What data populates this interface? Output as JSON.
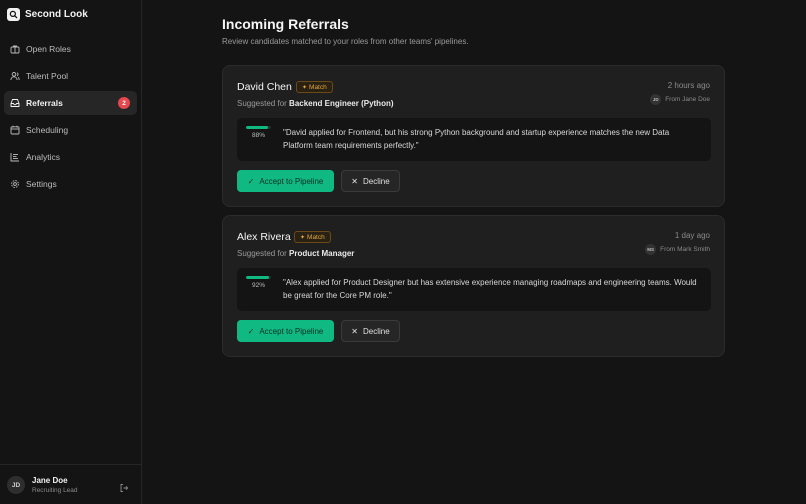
{
  "brand": {
    "name": "Second Look",
    "logo_icon": "search-icon"
  },
  "nav": {
    "items": [
      {
        "label": "Open Roles",
        "icon": "briefcase-icon"
      },
      {
        "label": "Talent Pool",
        "icon": "users-icon"
      },
      {
        "label": "Referrals",
        "icon": "inbox-icon",
        "badge": "2",
        "active": true
      },
      {
        "label": "Scheduling",
        "icon": "calendar-icon"
      },
      {
        "label": "Analytics",
        "icon": "chart-icon"
      },
      {
        "label": "Settings",
        "icon": "gear-icon"
      }
    ]
  },
  "user": {
    "initials": "JD",
    "name": "Jane Doe",
    "role": "Recruiting Lead"
  },
  "page": {
    "title": "Incoming Referrals",
    "subtitle": "Review candidates matched to your roles from other teams' pipelines."
  },
  "referrals": [
    {
      "name": "David Chen",
      "badge": "Match",
      "suggested_prefix": "Suggested for",
      "role": "Backend Engineer (Python)",
      "time": "2 hours ago",
      "from_initials": "JD",
      "from": "From Jane Doe",
      "score": "88%",
      "score_value": 0.88,
      "quote": "\"David applied for Frontend, but his strong Python background and startup experience matches the new Data Platform team requirements perfectly.\"",
      "accept_label": "Accept to Pipeline",
      "decline_label": "Decline"
    },
    {
      "name": "Alex Rivera",
      "badge": "Match",
      "suggested_prefix": "Suggested for",
      "role": "Product Manager",
      "time": "1 day ago",
      "from_initials": "MS",
      "from": "From Mark Smith",
      "score": "92%",
      "score_value": 0.92,
      "quote": "\"Alex applied for Product Designer but has extensive experience managing roadmaps and engineering teams. Would be great for the Core PM role.\"",
      "accept_label": "Accept to Pipeline",
      "decline_label": "Decline"
    }
  ],
  "colors": {
    "accent": "#10b981",
    "badge": "#e5484d",
    "match": "#e3a63d"
  }
}
